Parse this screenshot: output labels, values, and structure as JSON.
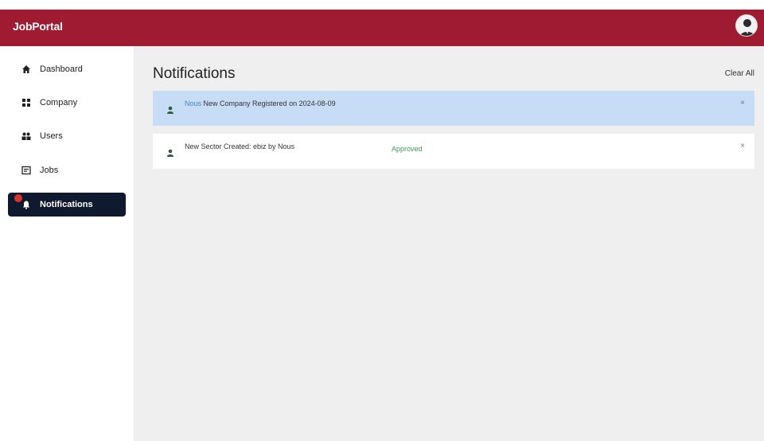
{
  "app": {
    "brand": "JobPortal"
  },
  "sidebar": {
    "items": [
      {
        "label": "Dashboard",
        "icon": "home-icon"
      },
      {
        "label": "Company",
        "icon": "company-icon"
      },
      {
        "label": "Users",
        "icon": "users-icon"
      },
      {
        "label": "Jobs",
        "icon": "jobs-icon"
      },
      {
        "label": "Notifications",
        "icon": "bell-icon",
        "active": true
      }
    ]
  },
  "main": {
    "title": "Notifications",
    "clear_all": "Clear All",
    "notifications": [
      {
        "user": "Nous",
        "text": " New Company Registered on 2024-08-09",
        "status": "",
        "close": "×"
      },
      {
        "user": "",
        "text": "New Sector Created: ebiz by Nous",
        "status": "Approved",
        "close": "×"
      }
    ]
  },
  "colors": {
    "header": "#9e1b32",
    "active_nav": "#0f1a2e",
    "unread_bg": "#c7dcf5",
    "status_approved": "#3a9a5a"
  }
}
